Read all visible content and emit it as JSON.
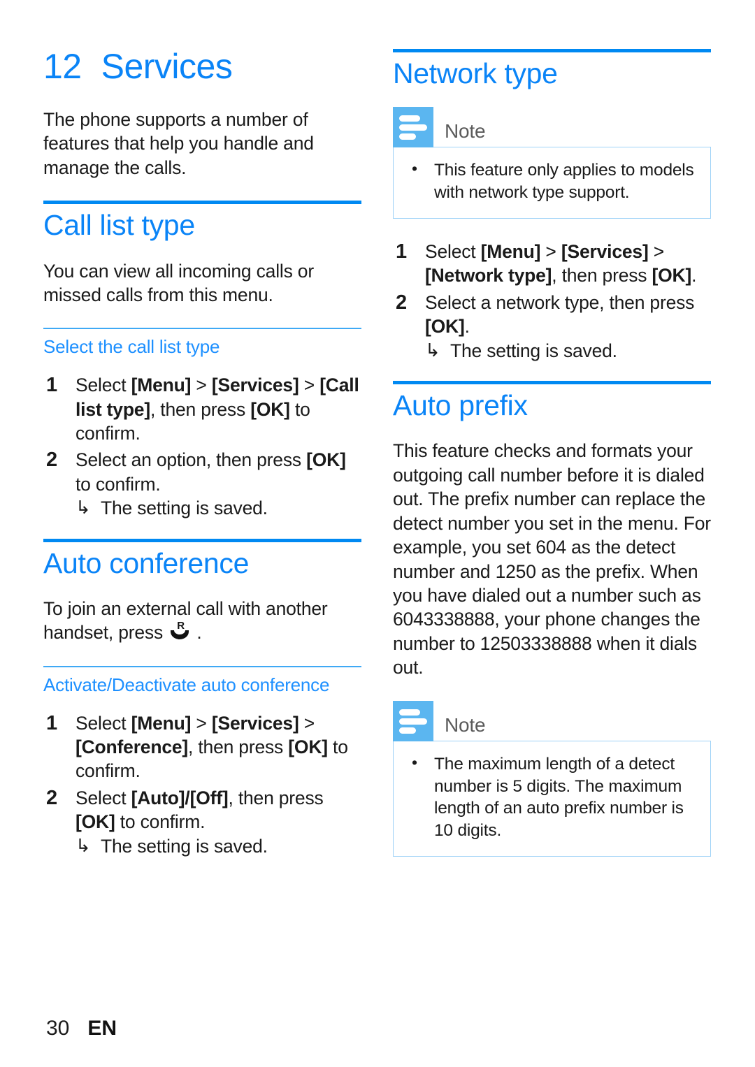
{
  "colors": {
    "heading_blue": "#0A84F7",
    "rule_heavy_blue": "#0089F2",
    "rule_thin_blue": "#3FA9F5",
    "subheading_blue": "#1E90FF",
    "note_icon_blue": "#5BB6F0",
    "note_border_blue": "#9ED2F7",
    "note_label_gray": "#5A5A5A"
  },
  "chapter": {
    "number": "12",
    "title": "Services",
    "intro": "The phone supports a number of features that help you handle and manage the calls."
  },
  "left_column": {
    "call_list_type": {
      "heading": "Call list type",
      "intro": "You can view all incoming calls or missed calls from this menu.",
      "subsection": {
        "heading": "Select the call list type",
        "steps": [
          {
            "num": "1",
            "parts": [
              {
                "t": "Select ",
                "b": false
              },
              {
                "t": "[Menu]",
                "b": true
              },
              {
                "t": " > ",
                "b": false
              },
              {
                "t": "[Services]",
                "b": true
              },
              {
                "t": " > ",
                "b": false
              },
              {
                "t": "[Call list type]",
                "b": true
              },
              {
                "t": ", then press ",
                "b": false
              },
              {
                "t": "[OK]",
                "b": true
              },
              {
                "t": " to confirm.",
                "b": false
              }
            ]
          },
          {
            "num": "2",
            "parts": [
              {
                "t": "Select an option, then press ",
                "b": false
              },
              {
                "t": "[OK]",
                "b": true
              },
              {
                "t": " to confirm.",
                "b": false
              }
            ],
            "result": "The setting is saved.",
            "result_arrow": "↳"
          }
        ]
      }
    },
    "auto_conference": {
      "heading": "Auto conference",
      "intro_before_icon": "To join an external call with another handset, press ",
      "icon_name": "recall-key-icon",
      "icon_letter": "R",
      "intro_after_icon": " .",
      "subsection": {
        "heading": "Activate/Deactivate auto conference",
        "steps": [
          {
            "num": "1",
            "parts": [
              {
                "t": "Select ",
                "b": false
              },
              {
                "t": "[Menu]",
                "b": true
              },
              {
                "t": " > ",
                "b": false
              },
              {
                "t": "[Services]",
                "b": true
              },
              {
                "t": " > ",
                "b": false
              },
              {
                "t": "[Conference]",
                "b": true
              },
              {
                "t": ", then press ",
                "b": false
              },
              {
                "t": "[OK]",
                "b": true
              },
              {
                "t": " to confirm.",
                "b": false
              }
            ]
          },
          {
            "num": "2",
            "parts": [
              {
                "t": "Select ",
                "b": false
              },
              {
                "t": "[Auto]/[Off]",
                "b": true
              },
              {
                "t": ", then press ",
                "b": false
              },
              {
                "t": "[OK]",
                "b": true
              },
              {
                "t": " to confirm.",
                "b": false
              }
            ],
            "result": "The setting is saved.",
            "result_arrow": "↳"
          }
        ]
      }
    }
  },
  "right_column": {
    "network_type": {
      "heading": "Network type",
      "note": {
        "label": "Note",
        "icon_name": "note-icon",
        "items": [
          "This feature only applies to models with network type support."
        ]
      },
      "steps": [
        {
          "num": "1",
          "parts": [
            {
              "t": "Select ",
              "b": false
            },
            {
              "t": "[Menu]",
              "b": true
            },
            {
              "t": " > ",
              "b": false
            },
            {
              "t": "[Services]",
              "b": true
            },
            {
              "t": " > ",
              "b": false
            },
            {
              "t": "[Network type]",
              "b": true
            },
            {
              "t": ", then press ",
              "b": false
            },
            {
              "t": "[OK]",
              "b": true
            },
            {
              "t": ".",
              "b": false
            }
          ]
        },
        {
          "num": "2",
          "parts": [
            {
              "t": "Select a network type, then press ",
              "b": false
            },
            {
              "t": "[OK]",
              "b": true
            },
            {
              "t": ".",
              "b": false
            }
          ],
          "result": "The setting is saved.",
          "result_arrow": "↳"
        }
      ]
    },
    "auto_prefix": {
      "heading": "Auto prefix",
      "body": "This feature checks and formats your outgoing call number before it is dialed out. The prefix number can replace the detect number you set in the menu. For example, you set 604 as the detect number and 1250 as the prefix. When you have dialed out a number such as 6043338888, your phone changes the number to 12503338888 when it dials out.",
      "note": {
        "label": "Note",
        "icon_name": "note-icon",
        "items": [
          "The maximum length of a detect number is 5 digits. The maximum length of an auto prefix number is 10 digits."
        ]
      }
    }
  },
  "footer": {
    "page_number": "30",
    "language": "EN"
  }
}
